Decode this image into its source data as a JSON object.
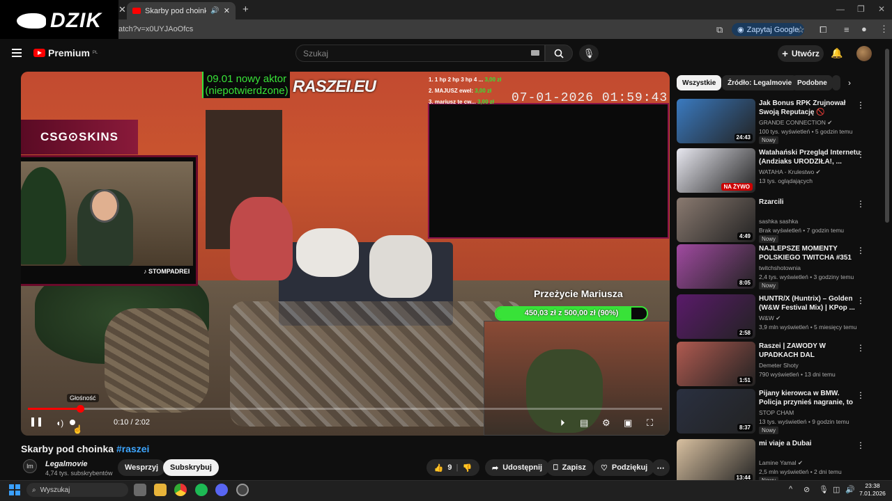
{
  "browser": {
    "tab_title": "Skarby pod choinka #raszei",
    "url": "atch?v=x0UYJAoOfcs",
    "ask_google": "Zapytaj Google"
  },
  "watermark": "DZIK",
  "header": {
    "logo_text": "Premium",
    "logo_region": "PL",
    "search_placeholder": "Szukaj",
    "create_label": "Utwórz"
  },
  "video_overlay": {
    "aktor_line1": "09.01 nowy aktor",
    "aktor_line2": "(niepotwierdzone)",
    "brand": "RASZEI.EU",
    "ticker": [
      {
        "text": "1. 1 hp 2 hp 3 hp 4 ...",
        "amount": "3,00 zł"
      },
      {
        "text": "2. MAJUSZ ewel:",
        "amount": "3,00 zł"
      },
      {
        "text": "3. mariusz te cw...",
        "amount": "3,00 zł"
      }
    ],
    "timestamp": "07-01-2026 01:59:43",
    "csgo": "CSG⊙SKINS",
    "tiktok": "STOMPADREI",
    "goal_title": "Przeżycie Mariusza",
    "goal_label": "450,03 zł z 500,00 zł (90%)",
    "goal_fraction": 0.9
  },
  "player": {
    "volume_tooltip": "Głośność",
    "time": "0:10 / 2:02",
    "progress_fraction": 0.082
  },
  "video": {
    "title": "Skarby pod choinka",
    "hashtag": "#raszei",
    "channel": "Legalmovie",
    "subs": "4,74 tys. subskrybentów",
    "channel_initials": "lm",
    "support": "Wesprzyj",
    "subscribe": "Subskrybuj",
    "likes": "9",
    "share": "Udostępnij",
    "save": "Zapisz",
    "thanks": "Podziękuj"
  },
  "sidebar": {
    "chips": [
      "Wszystkie",
      "Źródło: Legalmovie",
      "Podobne"
    ],
    "items": [
      {
        "title": "Jak Bonus RPK Zrujnował Swoją Reputację 🚫",
        "channel": "GRANDE CONNECTION ✔",
        "meta": "100 tys. wyświetleń • 5 godzin temu",
        "badge": "Nowy",
        "duration": "24:43",
        "color": "#3a7ac0"
      },
      {
        "title": "Watahański Przegląd Internetu (Andziaks URODZIŁA!, ...",
        "channel": "WATAHA - Krulestwo ✔",
        "meta": "13 tys. oglądających",
        "badge": "",
        "duration": "NA ŻYWO",
        "color": "#e8e8f0"
      },
      {
        "title": "Rzarcili",
        "channel": "sashka sashka",
        "meta": "Brak wyświetleń • 7 godzin temu",
        "badge": "Nowy",
        "duration": "4:49",
        "color": "#8a7a70"
      },
      {
        "title": "NAJLEPSZE MOMENTY POLSKIEGO TWITCHA #351",
        "channel": "twitchshotownia",
        "meta": "2,4 tys. wyświetleń • 3 godziny temu",
        "badge": "Nowy",
        "duration": "8:05",
        "color": "#a04aa0"
      },
      {
        "title": "HUNTR/X (Huntrix) – Golden (W&W Festival Mix) | KPop ...",
        "channel": "W&W ✔",
        "meta": "3,9 mln wyświetleń • 5 miesięcy temu",
        "badge": "",
        "duration": "2:58",
        "color": "#5a1a6a"
      },
      {
        "title": "Raszei | ZAWODY W UPADKACH DAL",
        "channel": "Demeter Shoty",
        "meta": "790 wyświetleń • 13 dni temu",
        "badge": "",
        "duration": "1:51",
        "color": "#b05a50"
      },
      {
        "title": "Pijany kierowca w BMW. Policja przynieś nagranie, to ukażemy...",
        "channel": "STOP CHAM",
        "meta": "13 tys. wyświetleń • 9 godzin temu",
        "badge": "Nowy",
        "duration": "8:37",
        "color": "#2a3040"
      },
      {
        "title": "mi viaje a Dubai",
        "channel": "Lamine Yamal ✔",
        "meta": "2,5 mln wyświetleń • 2 dni temu",
        "badge": "Nowy",
        "duration": "13:44",
        "color": "#d8c0a0"
      }
    ]
  },
  "taskbar": {
    "search": "Wyszukaj",
    "time": "23:38",
    "date": "7.01.2026"
  }
}
